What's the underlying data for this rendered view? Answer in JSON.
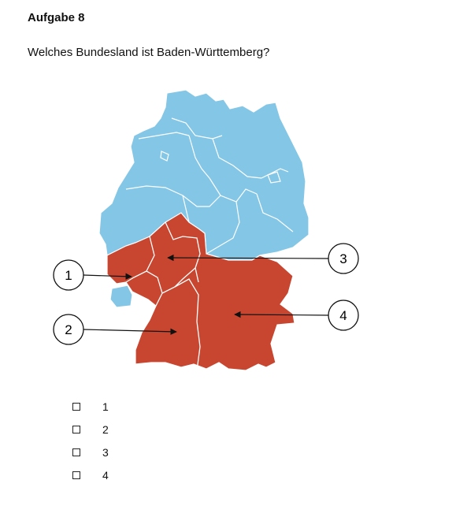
{
  "header": {
    "title": "Aufgabe 8",
    "question": "Welches Bundesland ist Baden-Württemberg?"
  },
  "map": {
    "colors": {
      "other_states": "#84c6e6",
      "highlighted_states": "#c8462f",
      "border": "#ffffff"
    },
    "markers": [
      "1",
      "2",
      "3",
      "4"
    ]
  },
  "answers": [
    {
      "label": "1",
      "checked": false
    },
    {
      "label": "2",
      "checked": false
    },
    {
      "label": "3",
      "checked": false
    },
    {
      "label": "4",
      "checked": false
    }
  ]
}
